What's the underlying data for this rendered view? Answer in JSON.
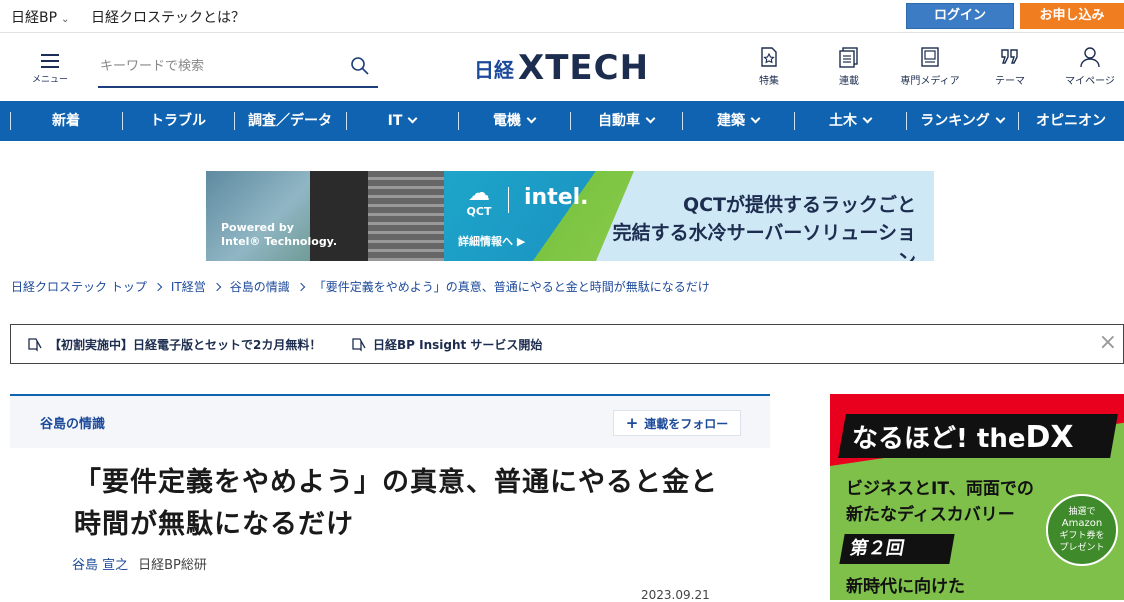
{
  "topbar": {
    "site_menu": "日経BP",
    "about": "日経クロステックとは？",
    "login": "ログイン",
    "signup": "お申し込み"
  },
  "header": {
    "menu_label": "メニュー",
    "search_placeholder": "キーワードで検索",
    "logo_prefix": "日経",
    "logo_main": "XTECH",
    "nav": [
      {
        "label": "特集",
        "icon": "star-page-icon"
      },
      {
        "label": "連載",
        "icon": "document-icon"
      },
      {
        "label": "専門メディア",
        "icon": "magazine-icon"
      },
      {
        "label": "テーマ",
        "icon": "quote-icon"
      },
      {
        "label": "マイページ",
        "icon": "user-icon"
      }
    ]
  },
  "main_nav": [
    {
      "label": "新着",
      "dropdown": false
    },
    {
      "label": "トラブル",
      "dropdown": false
    },
    {
      "label": "調査／データ",
      "dropdown": false
    },
    {
      "label": "IT",
      "dropdown": true
    },
    {
      "label": "電機",
      "dropdown": true
    },
    {
      "label": "自動車",
      "dropdown": true
    },
    {
      "label": "建築",
      "dropdown": true
    },
    {
      "label": "土木",
      "dropdown": true
    },
    {
      "label": "ランキング",
      "dropdown": true
    },
    {
      "label": "オピニオン",
      "dropdown": false
    }
  ],
  "banner": {
    "powered_line1": "Powered by",
    "powered_line2": "Intel® Technology.",
    "qct": "QCT",
    "intel": "intel.",
    "more": "詳細情報へ ▶",
    "copy_line1": "QCTが提供するラックごと",
    "copy_line2": "完結する水冷サーバーソリューション"
  },
  "breadcrumb": [
    "日経クロステック トップ",
    "IT経営",
    "谷島の情識",
    "「要件定義をやめよう」の真意、普通にやると金と時間が無駄になるだけ"
  ],
  "notices": [
    "【初割実施中】日経電子版とセットで2カ月無料！",
    "日経BP Insight サービス開始"
  ],
  "notice_close": "×",
  "article": {
    "series": "谷島の情識",
    "follow": "連載をフォロー",
    "follow_icon": "+",
    "title": "「要件定義をやめよう」の真意、普通にやると金と時間が無駄になるだけ",
    "author": "谷島 宣之",
    "org": "日経BP総研",
    "date": "2023.09.21"
  },
  "side_ad": {
    "brand_prefix": "なるほど! the",
    "brand_dx": "DX",
    "line1": "ビジネスとIT、両面での",
    "line2": "新たなディスカバリー",
    "badge_l1": "抽選で",
    "badge_l2": "Amazon",
    "badge_l3": "ギフト券を",
    "badge_l4": "プレゼント",
    "episode": "第２回",
    "line3": "新時代に向けた"
  },
  "colors": {
    "nav_blue": "#0f63b0",
    "login_blue": "#3b7cc4",
    "signup_orange": "#f17d21",
    "link_blue": "#1d4a9a"
  }
}
